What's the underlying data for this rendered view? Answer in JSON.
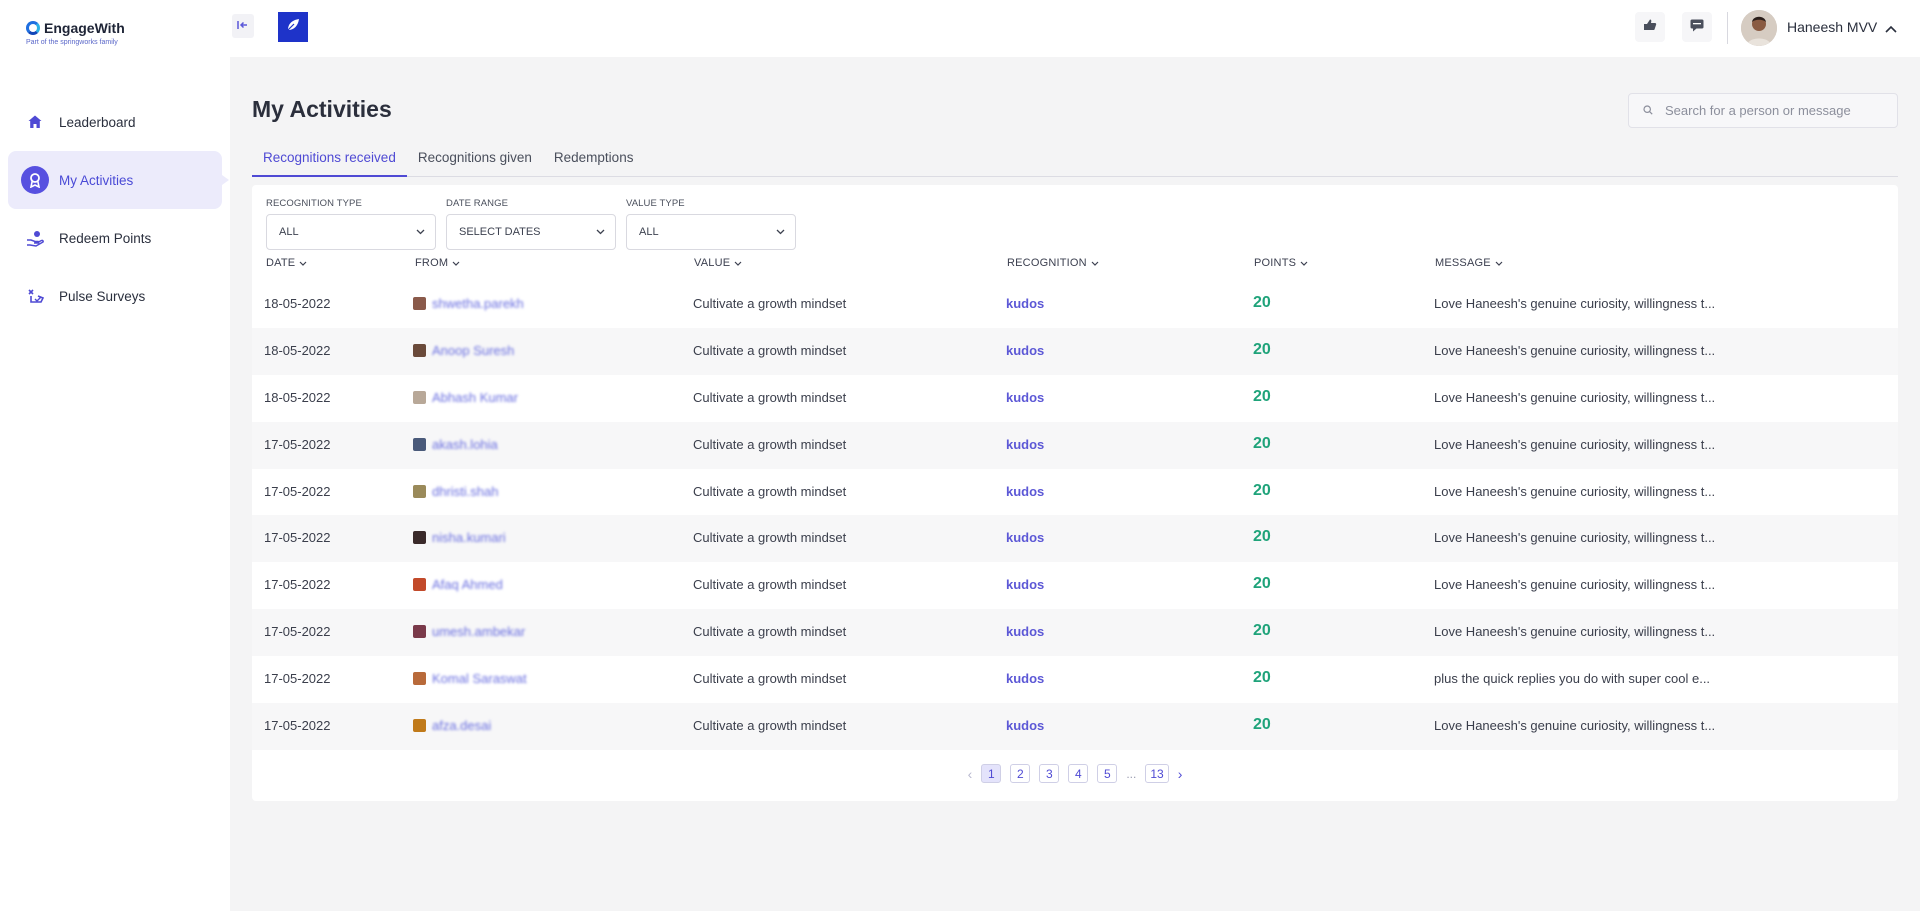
{
  "brand": {
    "name": "EngageWith",
    "tagline": "Part of the springworks family"
  },
  "colors": {
    "accent": "#4f4ad4",
    "points": "#1fa37a",
    "leaf_button": "#1e33c9"
  },
  "sidebar": {
    "items": [
      {
        "label": "Leaderboard",
        "icon": "home-icon",
        "active": false
      },
      {
        "label": "My Activities",
        "icon": "award-icon",
        "active": true
      },
      {
        "label": "Redeem Points",
        "icon": "hand-coin-icon",
        "active": false
      },
      {
        "label": "Pulse Surveys",
        "icon": "survey-icon",
        "active": false
      }
    ]
  },
  "header": {
    "user_name": "Haneesh MVV"
  },
  "main": {
    "title": "My Activities",
    "search_placeholder": "Search for a person or message",
    "tabs": [
      {
        "label": "Recognitions received",
        "active": true
      },
      {
        "label": "Recognitions given",
        "active": false
      },
      {
        "label": "Redemptions",
        "active": false
      }
    ],
    "filters": [
      {
        "label": "RECOGNITION TYPE",
        "value": "ALL"
      },
      {
        "label": "DATE RANGE",
        "value": "SELECT DATES"
      },
      {
        "label": "VALUE TYPE",
        "value": "ALL"
      }
    ],
    "columns": [
      "DATE",
      "FROM",
      "VALUE",
      "RECOGNITION",
      "POINTS",
      "MESSAGE"
    ],
    "rows": [
      {
        "date": "18-05-2022",
        "from": "shwetha.parekh",
        "value": "Cultivate a growth mindset",
        "recognition": "kudos",
        "points": "20",
        "message": "Love Haneesh's genuine curiosity, willingness t...",
        "avatar_color": "#8a5a4a"
      },
      {
        "date": "18-05-2022",
        "from": "Anoop Suresh",
        "value": "Cultivate a growth mindset",
        "recognition": "kudos",
        "points": "20",
        "message": "Love Haneesh's genuine curiosity, willingness t...",
        "avatar_color": "#6a4a3a"
      },
      {
        "date": "18-05-2022",
        "from": "Abhash Kumar",
        "value": "Cultivate a growth mindset",
        "recognition": "kudos",
        "points": "20",
        "message": "Love Haneesh's genuine curiosity, willingness t...",
        "avatar_color": "#b8a898"
      },
      {
        "date": "17-05-2022",
        "from": "akash.lohia",
        "value": "Cultivate a growth mindset",
        "recognition": "kudos",
        "points": "20",
        "message": "Love Haneesh's genuine curiosity, willingness t...",
        "avatar_color": "#4a5a7a"
      },
      {
        "date": "17-05-2022",
        "from": "dhristi.shah",
        "value": "Cultivate a growth mindset",
        "recognition": "kudos",
        "points": "20",
        "message": "Love Haneesh's genuine curiosity, willingness t...",
        "avatar_color": "#9a8a5a"
      },
      {
        "date": "17-05-2022",
        "from": "nisha.kumari",
        "value": "Cultivate a growth mindset",
        "recognition": "kudos",
        "points": "20",
        "message": "Love Haneesh's genuine curiosity, willingness t...",
        "avatar_color": "#3a2a2a"
      },
      {
        "date": "17-05-2022",
        "from": "Afaq Ahmed",
        "value": "Cultivate a growth mindset",
        "recognition": "kudos",
        "points": "20",
        "message": "Love Haneesh's genuine curiosity, willingness t...",
        "avatar_color": "#c24a2a"
      },
      {
        "date": "17-05-2022",
        "from": "umesh.ambekar",
        "value": "Cultivate a growth mindset",
        "recognition": "kudos",
        "points": "20",
        "message": "Love Haneesh's genuine curiosity, willingness t...",
        "avatar_color": "#7a3a4a"
      },
      {
        "date": "17-05-2022",
        "from": "Komal Saraswat",
        "value": "Cultivate a growth mindset",
        "recognition": "kudos",
        "points": "20",
        "message": "plus the quick replies you do with super cool e...",
        "avatar_color": "#b86a3a"
      },
      {
        "date": "17-05-2022",
        "from": "afza.desai",
        "value": "Cultivate a growth mindset",
        "recognition": "kudos",
        "points": "20",
        "message": "Love Haneesh's genuine curiosity, willingness t...",
        "avatar_color": "#c07a1a"
      }
    ],
    "pagination": {
      "pages": [
        "1",
        "2",
        "3",
        "4",
        "5"
      ],
      "ellipsis": "...",
      "last": "13",
      "current": "1"
    }
  }
}
